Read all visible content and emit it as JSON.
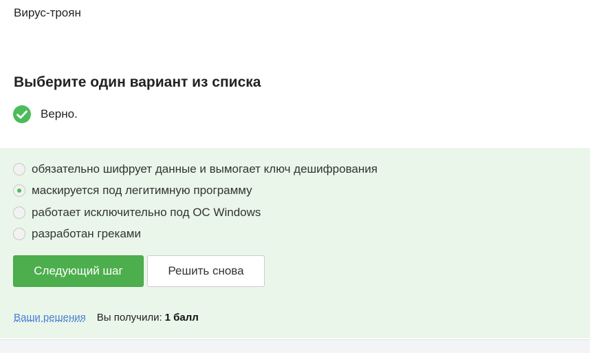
{
  "question": {
    "text": "Вирус-троян"
  },
  "prompt": "Выберите один вариант из списка",
  "verdict": {
    "text": "Верно.",
    "icon": "check-circle-icon",
    "color": "#4cbb5b"
  },
  "options": [
    {
      "label": "обязательно шифрует данные и вымогает ключ дешифрования",
      "selected": false
    },
    {
      "label": "маскируется под легитимную программу",
      "selected": true
    },
    {
      "label": "работает исключительно под ОС Windows",
      "selected": false
    },
    {
      "label": "разработан греками",
      "selected": false
    }
  ],
  "buttons": {
    "next": "Следующий шаг",
    "retry": "Решить снова"
  },
  "footer": {
    "solutions_link": "Ваши решения",
    "score_label": "Вы получили:",
    "score_value": "1 балл"
  },
  "colors": {
    "accent": "#4cae4c",
    "panel_bg": "#e9f6e9",
    "link": "#4a7fd6"
  }
}
